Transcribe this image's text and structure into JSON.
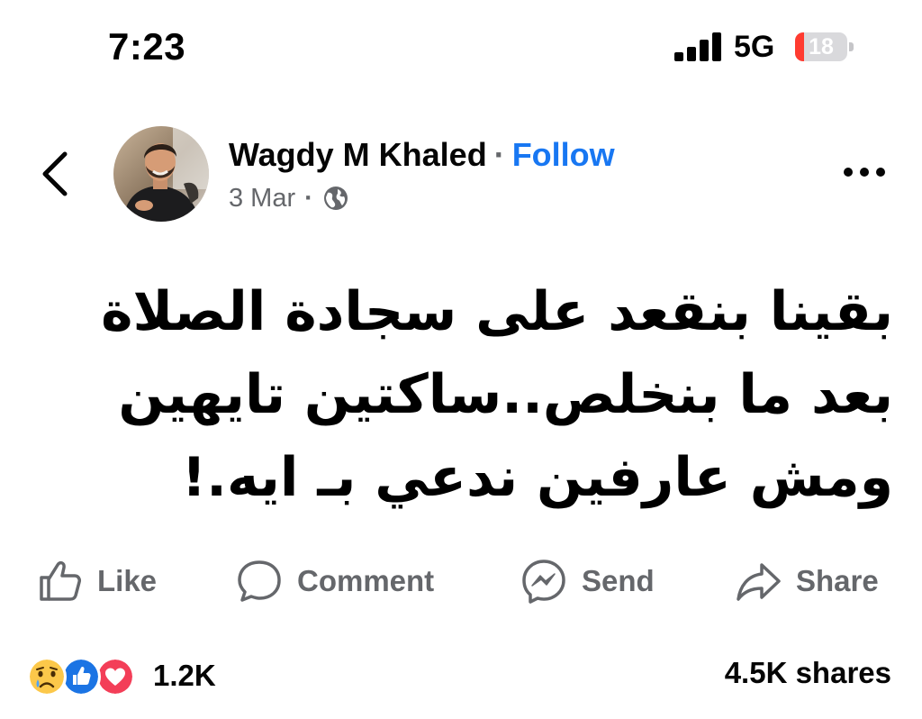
{
  "status_bar": {
    "time": "7:23",
    "network": "5G",
    "battery_level": "18",
    "battery_fraction": 0.18,
    "signal_bars": 4
  },
  "post": {
    "author": "Wagdy M Khaled",
    "separator": "·",
    "follow_label": "Follow",
    "date": "3 Mar",
    "meta_separator": "·",
    "privacy_icon": "globe-icon",
    "text": "بقينا بنقعد على سجادة الصلاة بعد ما بنخلص..ساكتين تايهين ومش عارفين ندعي بـ ايه.!"
  },
  "actions": {
    "like_label": "Like",
    "comment_label": "Comment",
    "send_label": "Send",
    "share_label": "Share"
  },
  "engagement": {
    "reaction_types": [
      "sad",
      "like",
      "love"
    ],
    "reactions_count": "1.2K",
    "shares": "4.5K shares"
  },
  "colors": {
    "link_blue": "#1877f2",
    "secondary_text": "#65676b",
    "battery_red": "#ff3b30",
    "like_blue": "#1b74e4",
    "love_red": "#f33e58",
    "sad_yellow": "#fcc84a"
  }
}
